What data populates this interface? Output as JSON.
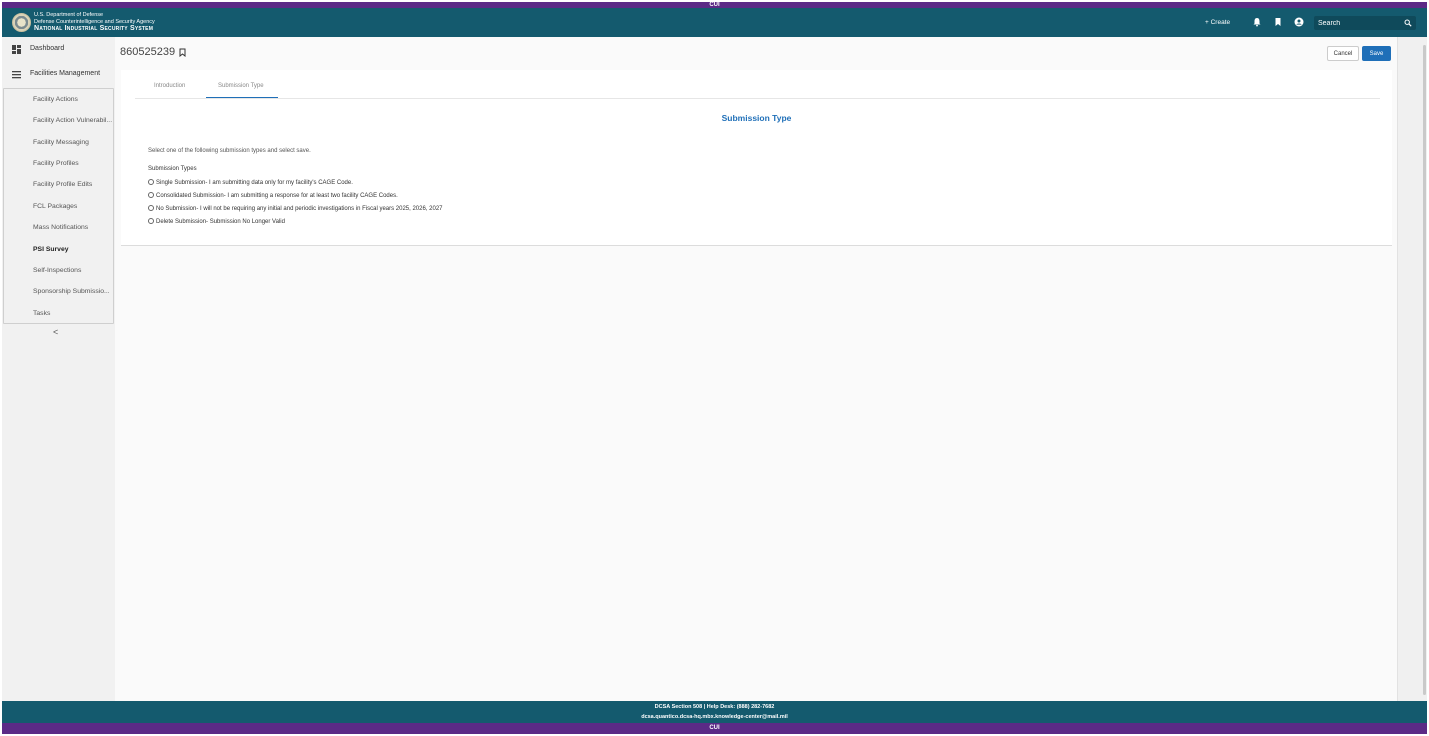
{
  "banner": {
    "top": "CUI",
    "bottom": "CUI"
  },
  "header": {
    "agency_line1": "U.S. Department of Defense",
    "agency_line2": "Defense Counterintelligence and Security Agency",
    "system_name": "National Industrial Security System",
    "create_label": "+ Create",
    "search_placeholder": "Search",
    "icons": [
      "bell-icon",
      "bookmark-icon",
      "account-icon",
      "search-icon"
    ]
  },
  "sidebar": {
    "dashboard": "Dashboard",
    "facilities_management": "Facilities Management",
    "items": [
      "Facility Actions",
      "Facility Action Vulnerabil...",
      "Facility Messaging",
      "Facility Profiles",
      "Facility Profile Edits",
      "FCL Packages",
      "Mass Notifications",
      "PSI Survey",
      "Self-Inspections",
      "Sponsorship Submissio...",
      "Tasks"
    ],
    "active_item": "PSI Survey",
    "collapse_glyph": "<"
  },
  "main": {
    "record_id": "860525239",
    "cancel_label": "Cancel",
    "save_label": "Save",
    "tabs": [
      {
        "label": "Introduction",
        "active": false
      },
      {
        "label": "Submission Type",
        "active": true
      }
    ],
    "section_title": "Submission Type",
    "instructions": "Select one of the following submission types and select save.",
    "types_label": "Submission Types",
    "options": [
      "Single Submission- I am submitting data only for my facility's CAGE Code.",
      "Consolidated Submission- I am submitting a response for at least two facility CAGE Codes.",
      "No Submission- I will not be requiring any initial and periodic investigations in Fiscal years 2025, 2026, 2027",
      "Delete Submission- Submission No Longer Valid"
    ]
  },
  "footer": {
    "line1": "DCSA Section 508 | Help Desk: (888) 282-7682",
    "line2": "dcsa.quantico.dcsa-hq.mbx.knowledge-center@mail.mil"
  },
  "colors": {
    "header": "#145a6e",
    "banner": "#5b2a86",
    "accent": "#1f6fb8"
  }
}
